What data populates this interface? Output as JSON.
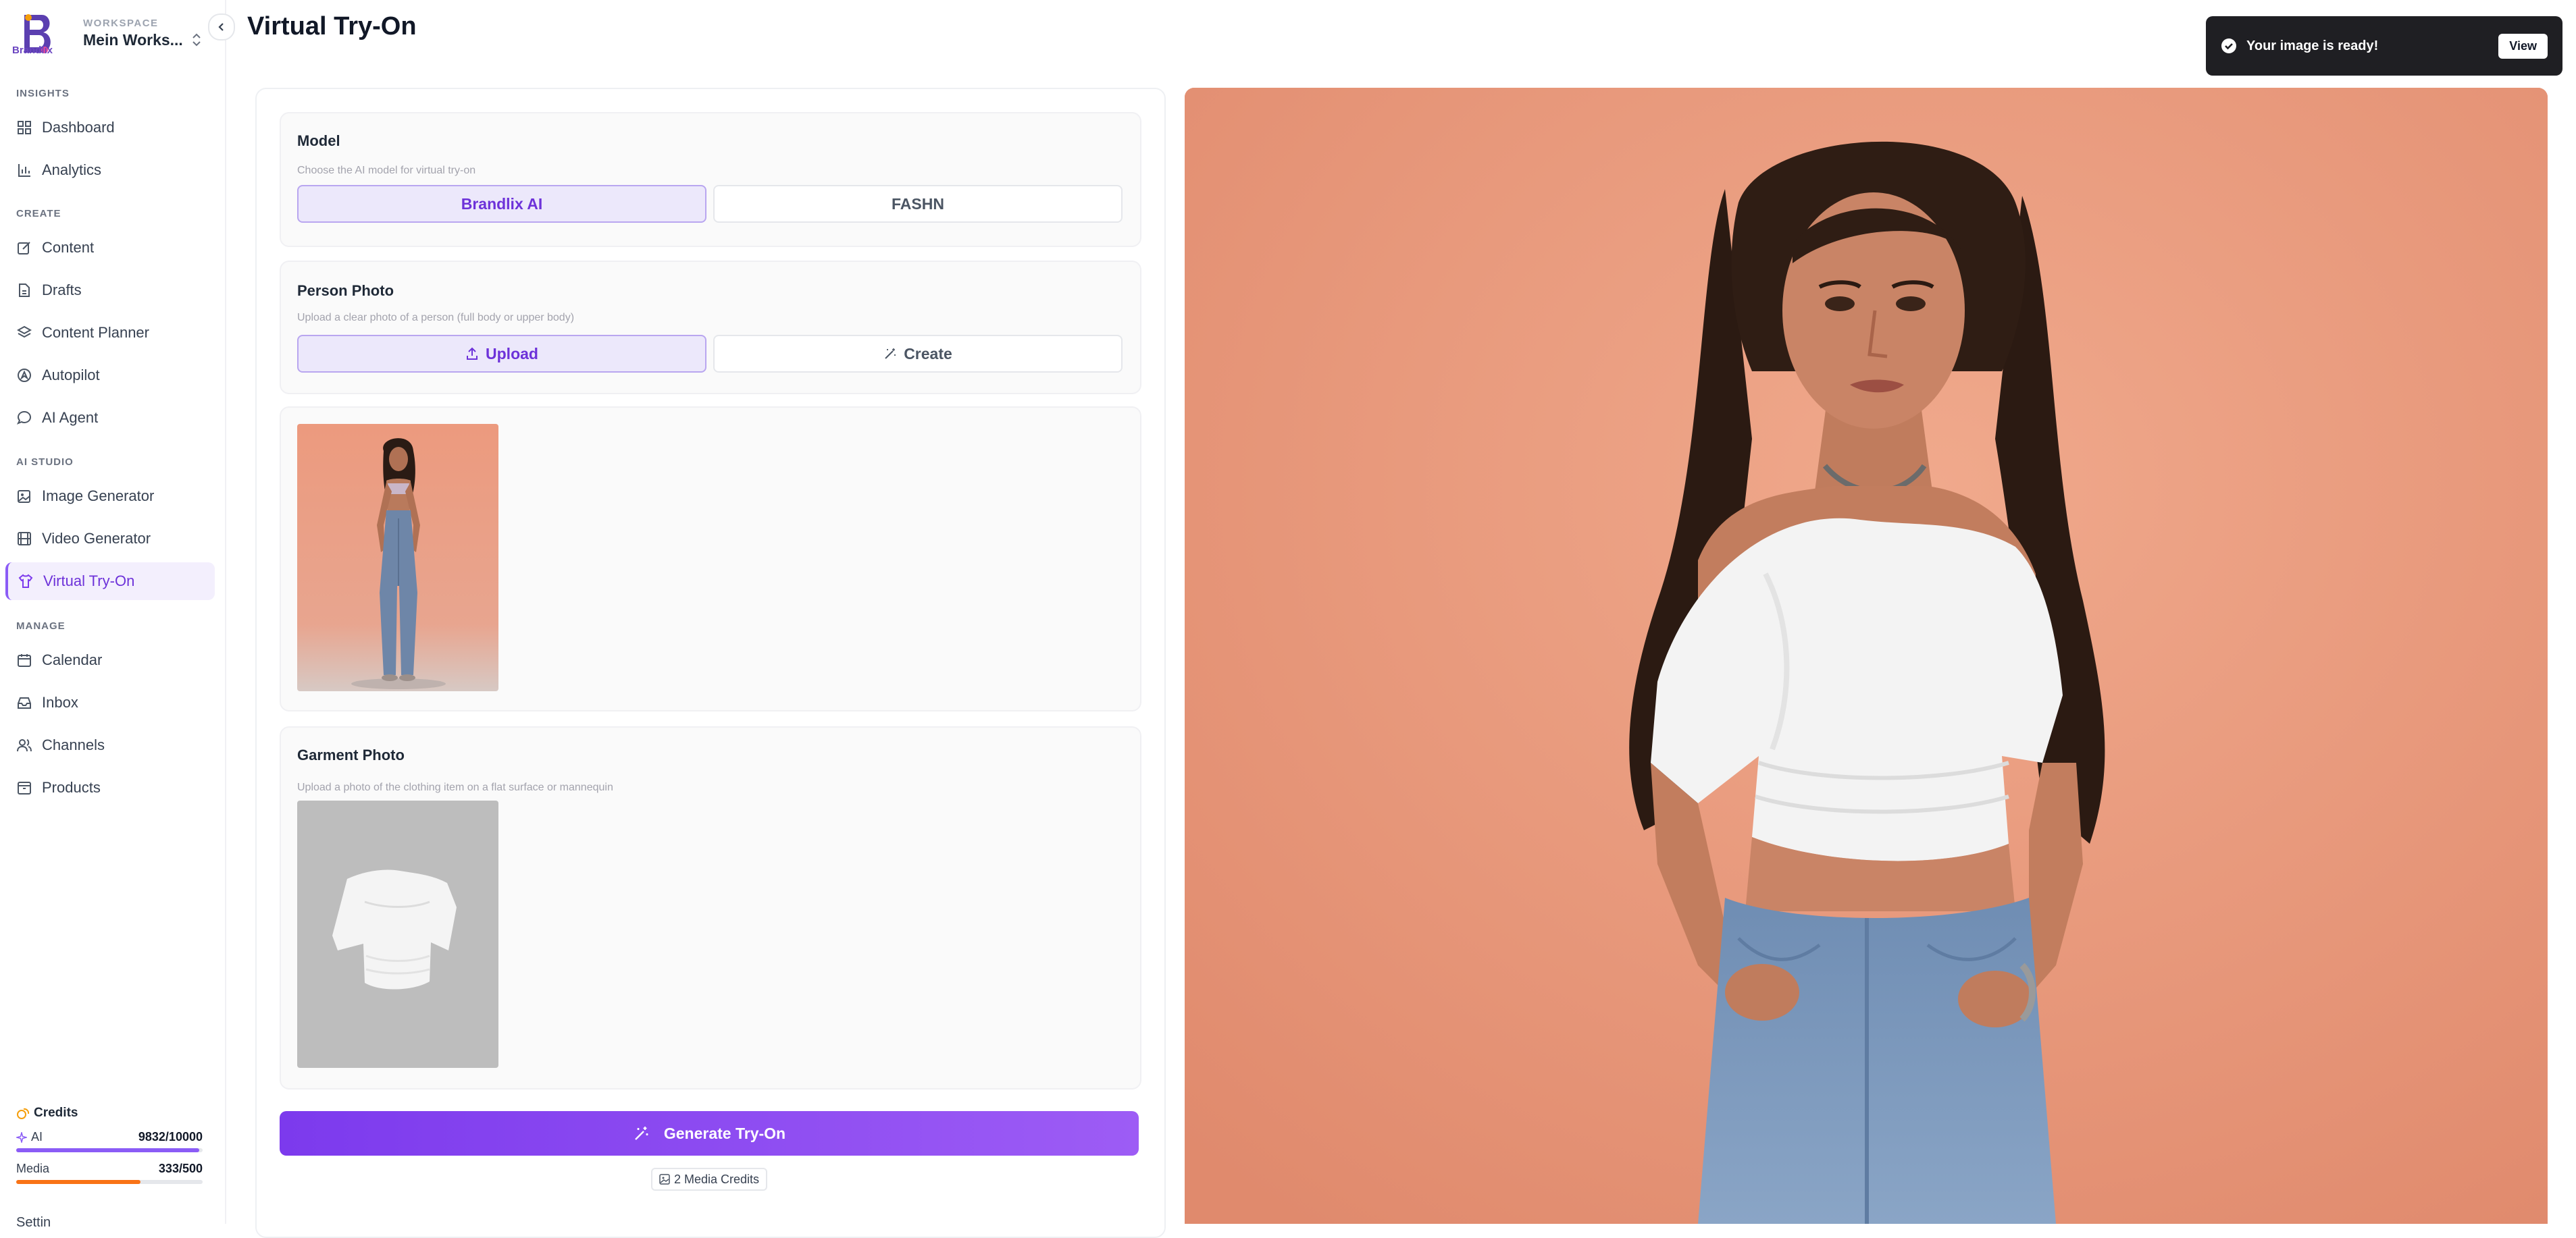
{
  "sidebar": {
    "brand_word": "Brandlix",
    "workspace_label": "WORKSPACE",
    "workspace_name": "Mein Works...",
    "sections": {
      "insights": "INSIGHTS",
      "create": "CREATE",
      "ai_studio": "AI STUDIO",
      "manage": "MANAGE"
    },
    "items": {
      "dashboard": "Dashboard",
      "analytics": "Analytics",
      "content": "Content",
      "drafts": "Drafts",
      "content_planner": "Content Planner",
      "autopilot": "Autopilot",
      "ai_agent": "AI Agent",
      "image_generator": "Image Generator",
      "video_generator": "Video Generator",
      "virtual_try_on": "Virtual Try-On",
      "calendar": "Calendar",
      "inbox": "Inbox",
      "channels": "Channels",
      "products": "Products"
    },
    "active_item": "virtual_try_on",
    "credits": {
      "title": "Credits",
      "ai_label": "AI",
      "ai_value": "9832/10000",
      "ai_fraction": 0.9832,
      "media_label": "Media",
      "media_value": "333/500",
      "media_fraction": 0.666,
      "ai_color": "#8b5cf6",
      "media_color": "#f97316"
    },
    "settings_stub": "Settin"
  },
  "page": {
    "title": "Virtual Try-On"
  },
  "model_card": {
    "title": "Model",
    "subtitle": "Choose the AI model for virtual try-on",
    "options": [
      "Brandlix AI",
      "FASHN"
    ],
    "selected": "Brandlix AI"
  },
  "person_card": {
    "title": "Person Photo",
    "subtitle": "Upload a clear photo of a person (full body or upper body)",
    "upload_label": "Upload",
    "create_label": "Create",
    "selected": "Upload"
  },
  "garment_card": {
    "title": "Garment Photo",
    "subtitle": "Upload a photo of the clothing item on a flat surface or mannequin"
  },
  "actions": {
    "generate_label": "Generate Try-On",
    "media_credits": "2 Media Credits"
  },
  "toast": {
    "message": "Your image is ready!",
    "button": "View"
  },
  "colors": {
    "accent": "#7c3aed",
    "result_background": "#e9967a"
  }
}
